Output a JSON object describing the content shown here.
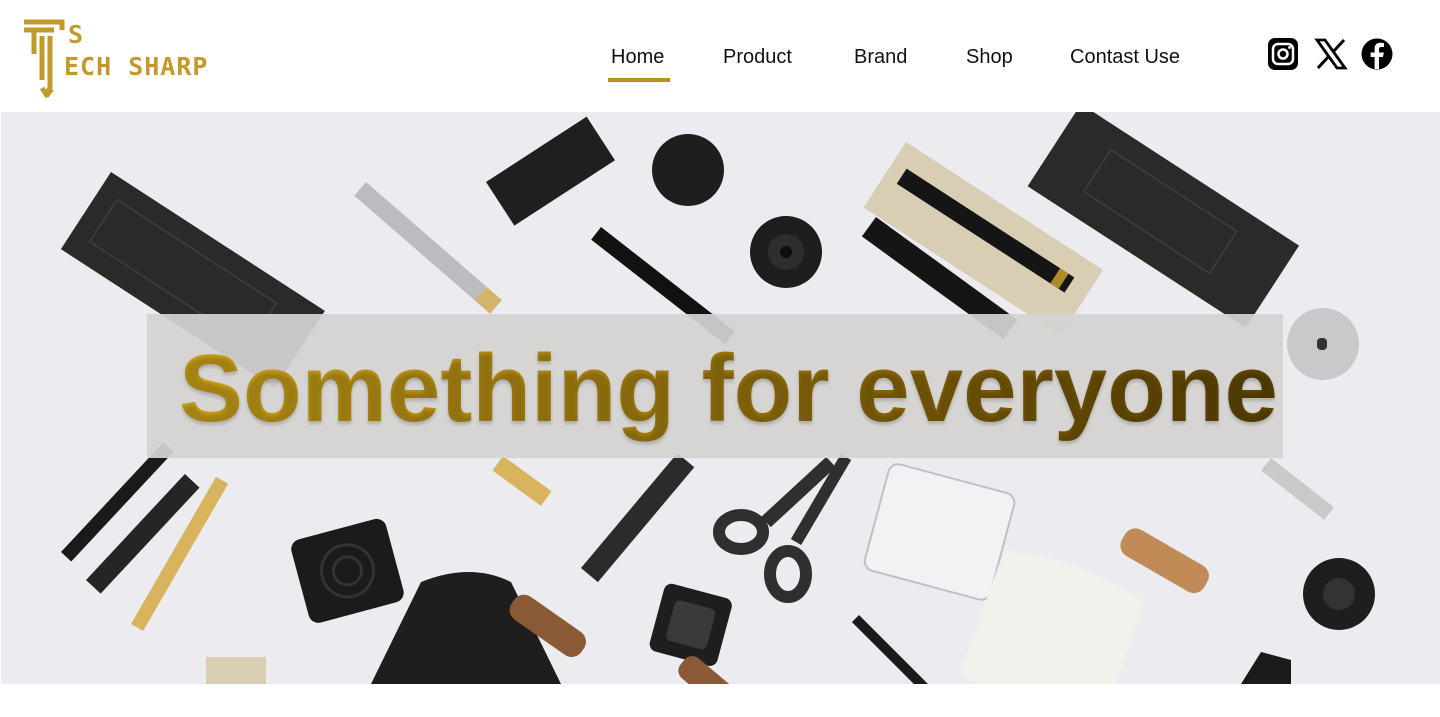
{
  "brand": {
    "logo_mark": "S",
    "logo_text": "ECH SHARP",
    "name": "Tech Sharp",
    "color": "#c29a2c"
  },
  "nav": {
    "items": [
      {
        "label": "Home",
        "active": true
      },
      {
        "label": "Product"
      },
      {
        "label": "Brand"
      },
      {
        "label": "Shop"
      },
      {
        "label": "Contast Use"
      }
    ],
    "active_color": "#b8901e"
  },
  "social": [
    {
      "icon": "instagram-icon"
    },
    {
      "icon": "x-twitter-icon"
    },
    {
      "icon": "facebook-icon"
    }
  ],
  "hero": {
    "headline": "Something for everyone",
    "image": "stationery-flatlay"
  }
}
